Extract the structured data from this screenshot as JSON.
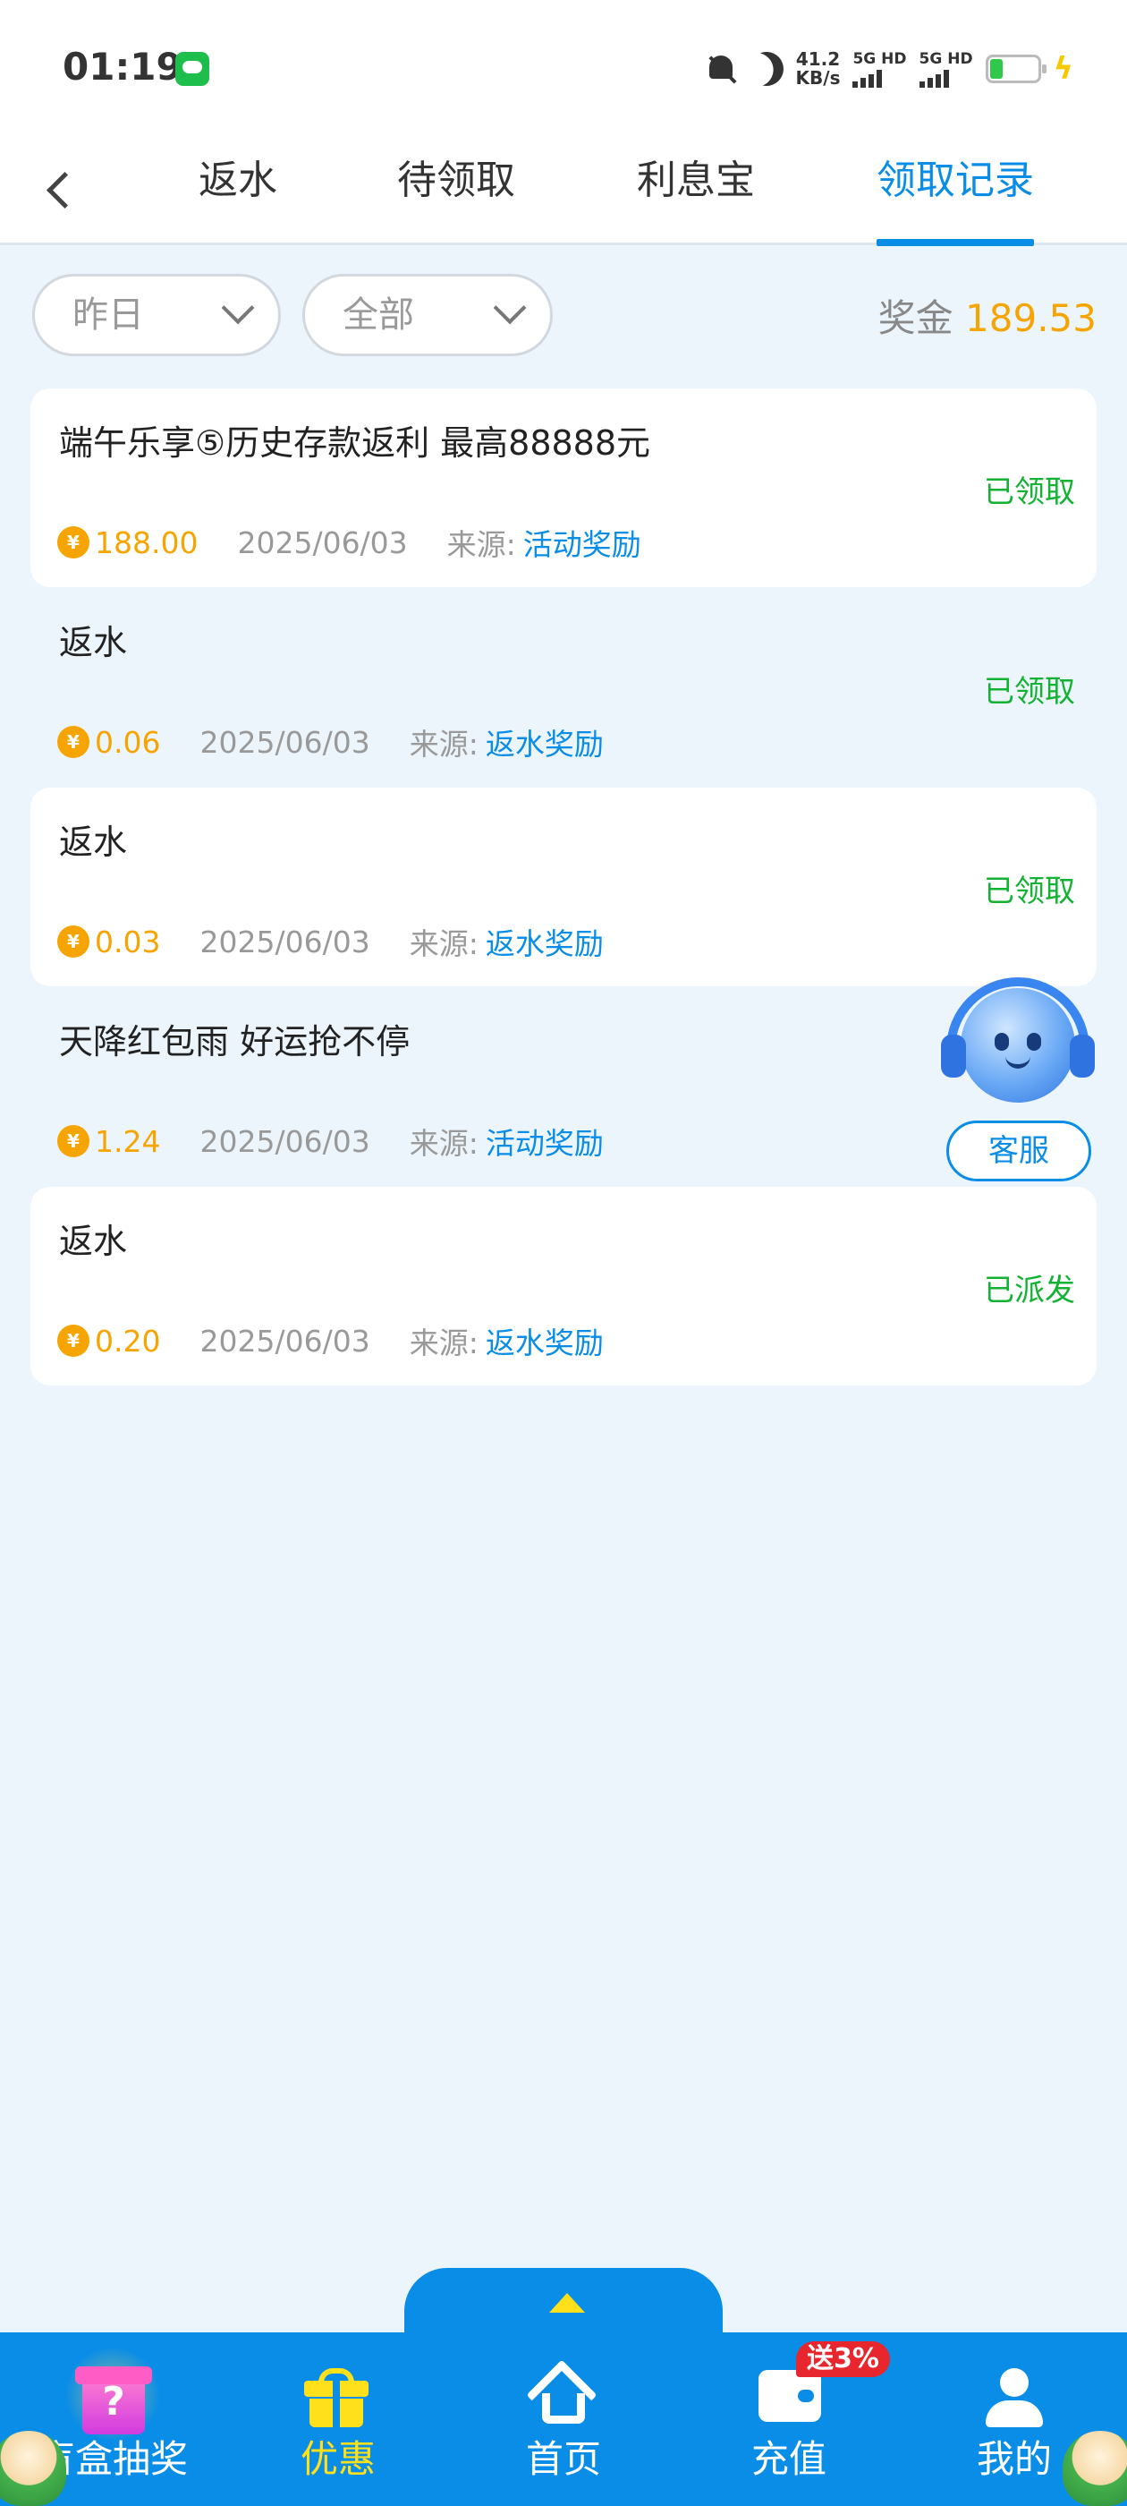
{
  "status_bar": {
    "time": "01:19",
    "net_speed_value": "41.2",
    "net_speed_unit": "KB/s",
    "sim1": "5G HD",
    "sim2": "5G HD",
    "icons": [
      "app-icon",
      "mute-icon",
      "moon-icon",
      "signal-icon",
      "battery-icon",
      "charging-icon"
    ]
  },
  "tabs": [
    {
      "label": "返水",
      "active": false
    },
    {
      "label": "待领取",
      "active": false
    },
    {
      "label": "利息宝",
      "active": false
    },
    {
      "label": "领取记录",
      "active": true
    }
  ],
  "filters": {
    "date": "昨日",
    "type": "全部"
  },
  "summary": {
    "label": "奖金",
    "amount": "189.53"
  },
  "records": [
    {
      "title": "端午乐享⑤历史存款返利 最高88888元",
      "amount": "188.00",
      "date": "2025/06/03",
      "source_label": "来源:",
      "source": "活动奖励",
      "status": "已领取"
    },
    {
      "title": "返水",
      "amount": "0.06",
      "date": "2025/06/03",
      "source_label": "来源:",
      "source": "返水奖励",
      "status": "已领取"
    },
    {
      "title": "返水",
      "amount": "0.03",
      "date": "2025/06/03",
      "source_label": "来源:",
      "source": "返水奖励",
      "status": "已领取"
    },
    {
      "title": "天降红包雨 好运抢不停",
      "amount": "1.24",
      "date": "2025/06/03",
      "source_label": "来源:",
      "source": "活动奖励",
      "status": ""
    },
    {
      "title": "返水",
      "amount": "0.20",
      "date": "2025/06/03",
      "source_label": "来源:",
      "source": "返水奖励",
      "status": "已派发"
    }
  ],
  "coin_symbol": "¥",
  "service": {
    "label": "客服"
  },
  "bottom_nav": [
    {
      "label": "盲盒抽奖",
      "icon": "mystery-box-icon",
      "active": false
    },
    {
      "label": "优惠",
      "icon": "gift-icon",
      "active": true
    },
    {
      "label": "首页",
      "icon": "home-icon",
      "active": false
    },
    {
      "label": "充值",
      "icon": "wallet-icon",
      "active": false,
      "badge": "送3%"
    },
    {
      "label": "我的",
      "icon": "user-icon",
      "active": false
    }
  ],
  "colors": {
    "accent": "#0a8de6",
    "amount": "#f6a400",
    "status_green": "#13b233",
    "nav_active": "#ffe01a",
    "badge_red": "#e8262e"
  }
}
